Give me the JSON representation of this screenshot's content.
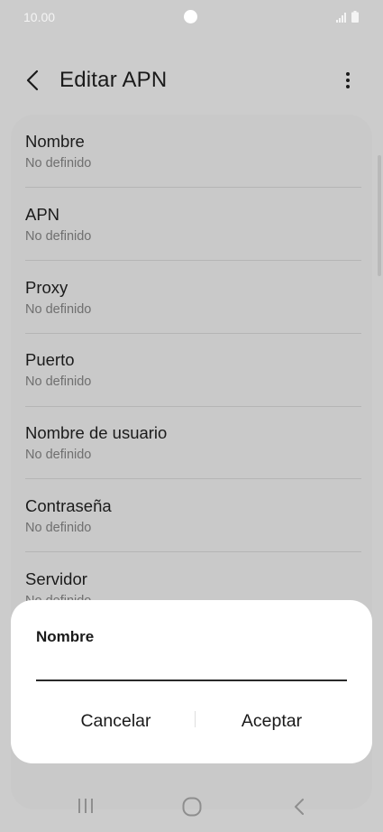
{
  "status": {
    "time": "10.00"
  },
  "header": {
    "title": "Editar APN",
    "back_icon": "chevron-left-icon",
    "more_icon": "more-vertical-icon"
  },
  "list": {
    "items": [
      {
        "title": "Nombre",
        "subtitle": "No definido"
      },
      {
        "title": "APN",
        "subtitle": "No definido"
      },
      {
        "title": "Proxy",
        "subtitle": "No definido"
      },
      {
        "title": "Puerto",
        "subtitle": "No definido"
      },
      {
        "title": "Nombre de usuario",
        "subtitle": "No definido"
      },
      {
        "title": "Contraseña",
        "subtitle": "No definido"
      },
      {
        "title": "Servidor",
        "subtitle": "No definido"
      }
    ]
  },
  "dialog": {
    "title": "Nombre",
    "input_value": "",
    "cancel_label": "Cancelar",
    "accept_label": "Aceptar"
  },
  "colors": {
    "dimmed_background": "#cccccc",
    "dialog_background": "#ffffff",
    "text_primary": "#1a1a1a",
    "text_secondary": "#6f6f6f"
  }
}
